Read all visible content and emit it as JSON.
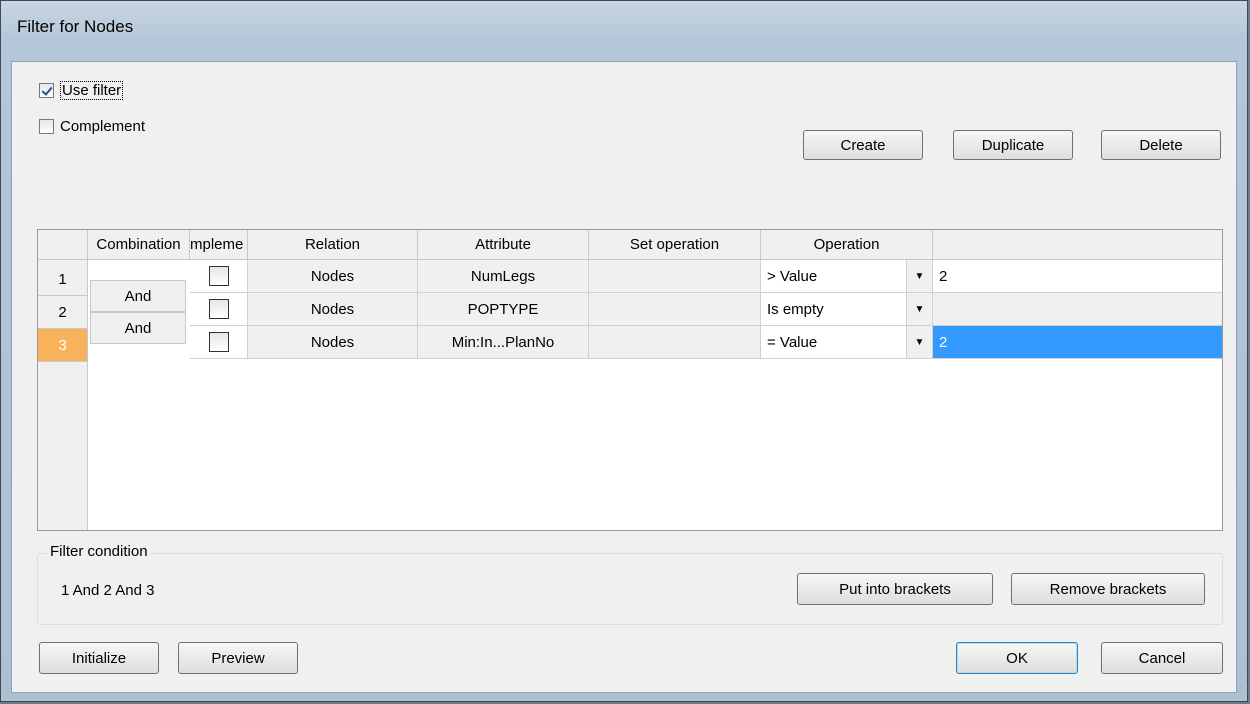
{
  "window": {
    "title": "Filter for Nodes"
  },
  "options": {
    "use_filter": {
      "label": "Use filter",
      "checked": true
    },
    "complement": {
      "label": "Complement",
      "checked": false
    }
  },
  "toolbar": {
    "create": "Create",
    "duplicate": "Duplicate",
    "delete": "Delete"
  },
  "table": {
    "headers": [
      "",
      "Combination",
      "mpleme",
      "Relation",
      "Attribute",
      "Set operation",
      "Operation",
      ""
    ],
    "rows": [
      {
        "num": "1",
        "complement": false,
        "relation": "Nodes",
        "attribute": "NumLegs",
        "set_operation": "",
        "operation": "> Value",
        "value": "2",
        "selected": false
      },
      {
        "num": "2",
        "complement": false,
        "relation": "Nodes",
        "attribute": "POPTYPE",
        "set_operation": "",
        "operation": "Is empty",
        "value": "",
        "selected": false
      },
      {
        "num": "3",
        "complement": false,
        "relation": "Nodes",
        "attribute": "Min:In...PlanNo",
        "set_operation": "",
        "operation": "= Value",
        "value": "2",
        "selected": true
      }
    ],
    "combinations": [
      "And",
      "And"
    ]
  },
  "condition": {
    "group_label": "Filter condition",
    "text": "1 And 2 And 3",
    "put_brackets": "Put into brackets",
    "remove_brackets": "Remove brackets"
  },
  "footer": {
    "initialize": "Initialize",
    "preview": "Preview",
    "ok": "OK",
    "cancel": "Cancel"
  }
}
